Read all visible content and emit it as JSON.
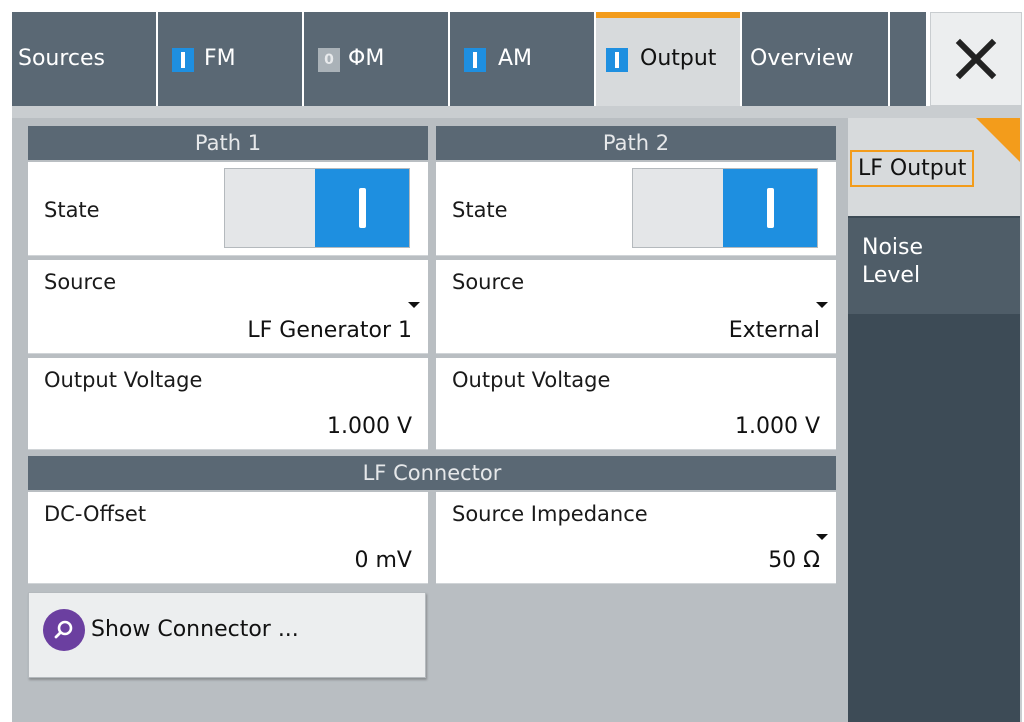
{
  "tabs": [
    {
      "label": "Sources",
      "indicator": "none"
    },
    {
      "label": "FM",
      "indicator": "on"
    },
    {
      "label": "ΦM",
      "indicator": "off",
      "indicator_text": "0"
    },
    {
      "label": "AM",
      "indicator": "on"
    },
    {
      "label": "Output",
      "indicator": "on",
      "selected": true
    },
    {
      "label": "Overview",
      "indicator": "none"
    }
  ],
  "close_icon": "close-x-icon",
  "path1": {
    "header": "Path 1",
    "state_label": "State",
    "state_on": true,
    "source_label": "Source",
    "source_value": "LF Generator 1",
    "voltage_label": "Output Voltage",
    "voltage_value": "1.000 V"
  },
  "path2": {
    "header": "Path 2",
    "state_label": "State",
    "state_on": true,
    "source_label": "Source",
    "source_value": "External",
    "voltage_label": "Output Voltage",
    "voltage_value": "1.000 V"
  },
  "connector": {
    "header": "LF Connector",
    "dc_offset_label": "DC-Offset",
    "dc_offset_value": "0 mV",
    "impedance_label": "Source Impedance",
    "impedance_value": "50 Ω",
    "show_button_label": "Show Connector ...",
    "show_button_icon": "magnifier-icon"
  },
  "sidenav": {
    "items": [
      {
        "label": "LF Output",
        "selected": true
      },
      {
        "label": "Noise Level",
        "lines": [
          "Noise",
          "Level"
        ],
        "selected": false
      }
    ]
  },
  "colors": {
    "tab_bg": "#5a6874",
    "selected_accent": "#f39c1b",
    "toggle_on": "#1e8fe0",
    "sidebar_bg": "#3d4b56",
    "search_icon": "#6b3fa0"
  }
}
